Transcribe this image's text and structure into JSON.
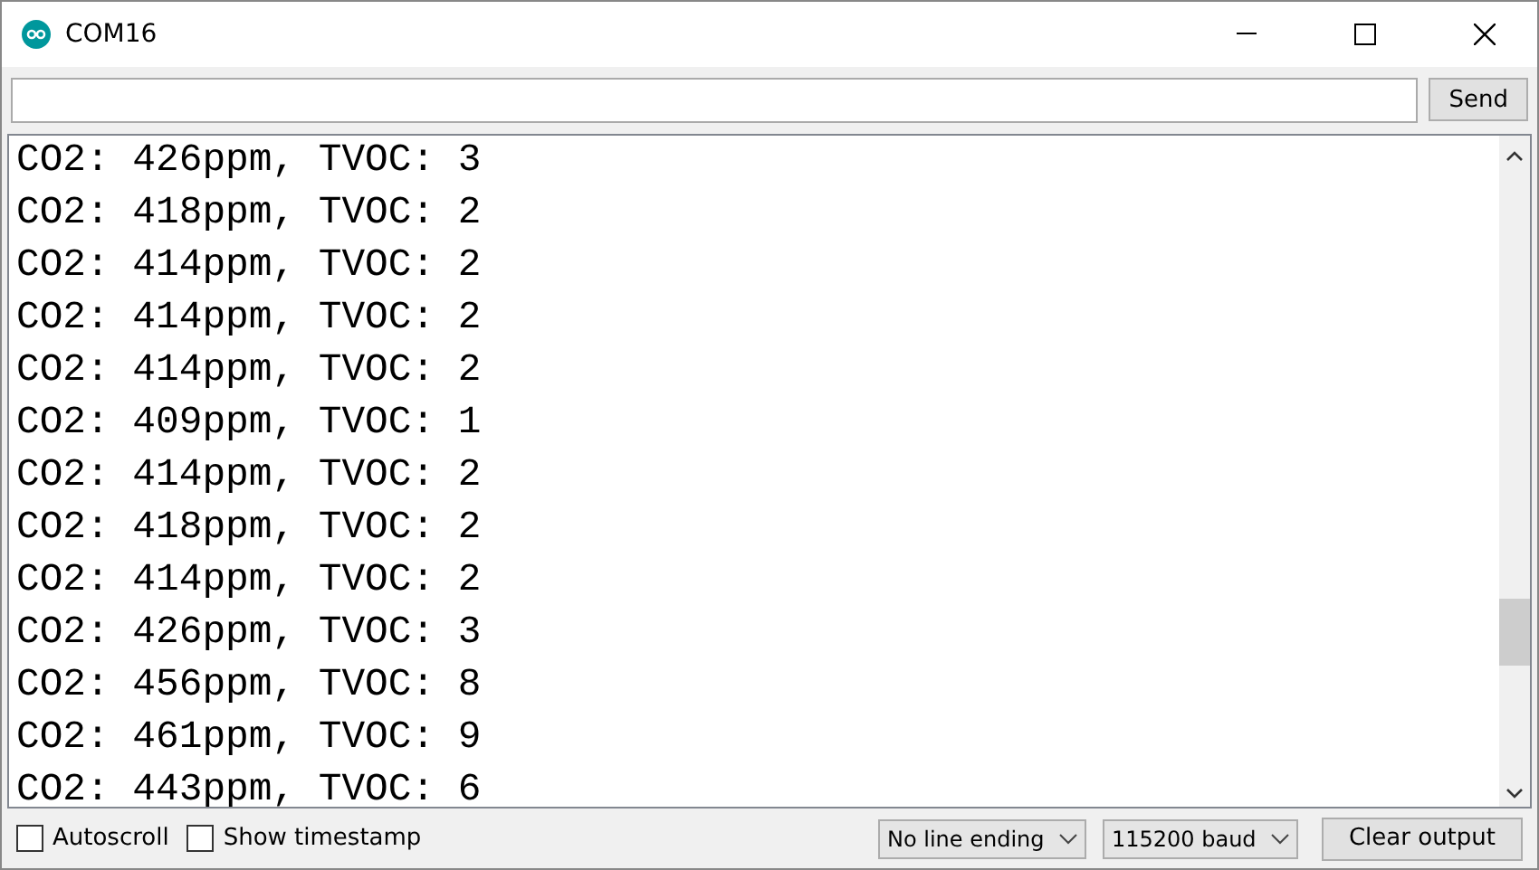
{
  "window": {
    "title": "COM16"
  },
  "send_button": "Send",
  "output_lines": [
    "CO2: 426ppm, TVOC: 3",
    "CO2: 418ppm, TVOC: 2",
    "CO2: 414ppm, TVOC: 2",
    "CO2: 414ppm, TVOC: 2",
    "CO2: 414ppm, TVOC: 2",
    "CO2: 409ppm, TVOC: 1",
    "CO2: 414ppm, TVOC: 2",
    "CO2: 418ppm, TVOC: 2",
    "CO2: 414ppm, TVOC: 2",
    "CO2: 426ppm, TVOC: 3",
    "CO2: 456ppm, TVOC: 8",
    "CO2: 461ppm, TVOC: 9",
    "CO2: 443ppm, TVOC: 6"
  ],
  "status_bar": {
    "checkboxes": [
      {
        "label": "Autoscroll",
        "checked": false
      },
      {
        "label": "Show timestamp",
        "checked": false
      }
    ],
    "dropdowns": [
      {
        "value": "No line ending"
      },
      {
        "value": "115200 baud"
      }
    ],
    "clear_button": "Clear output"
  }
}
